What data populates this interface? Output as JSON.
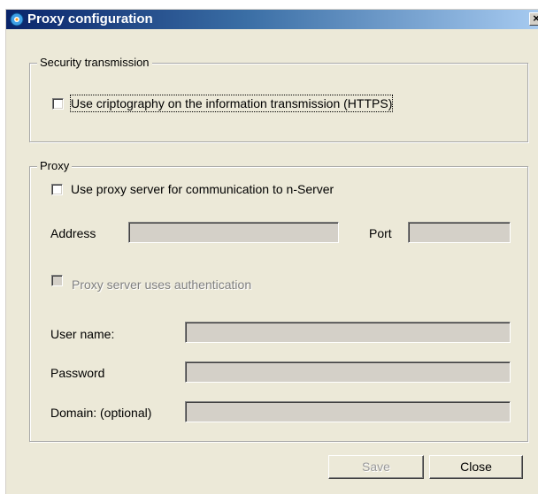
{
  "window": {
    "title": "Proxy configuration",
    "close_glyph": "×",
    "app_icon": "gear-globe-icon"
  },
  "security": {
    "legend": "Security transmission",
    "https_label": "Use criptography on the information transmission (HTTPS)",
    "https_checked": false
  },
  "proxy": {
    "legend": "Proxy",
    "use_proxy_label": "Use proxy server for communication to n-Server",
    "use_proxy_checked": false,
    "address_label": "Address",
    "address_value": "",
    "port_label": "Port",
    "port_value": "",
    "auth_label": "Proxy server uses authentication",
    "auth_checked": false,
    "username_label": "User name:",
    "username_value": "",
    "password_label": "Password",
    "password_value": "",
    "domain_label": "Domain: (optional)",
    "domain_value": ""
  },
  "buttons": {
    "save": "Save",
    "close": "Close"
  }
}
